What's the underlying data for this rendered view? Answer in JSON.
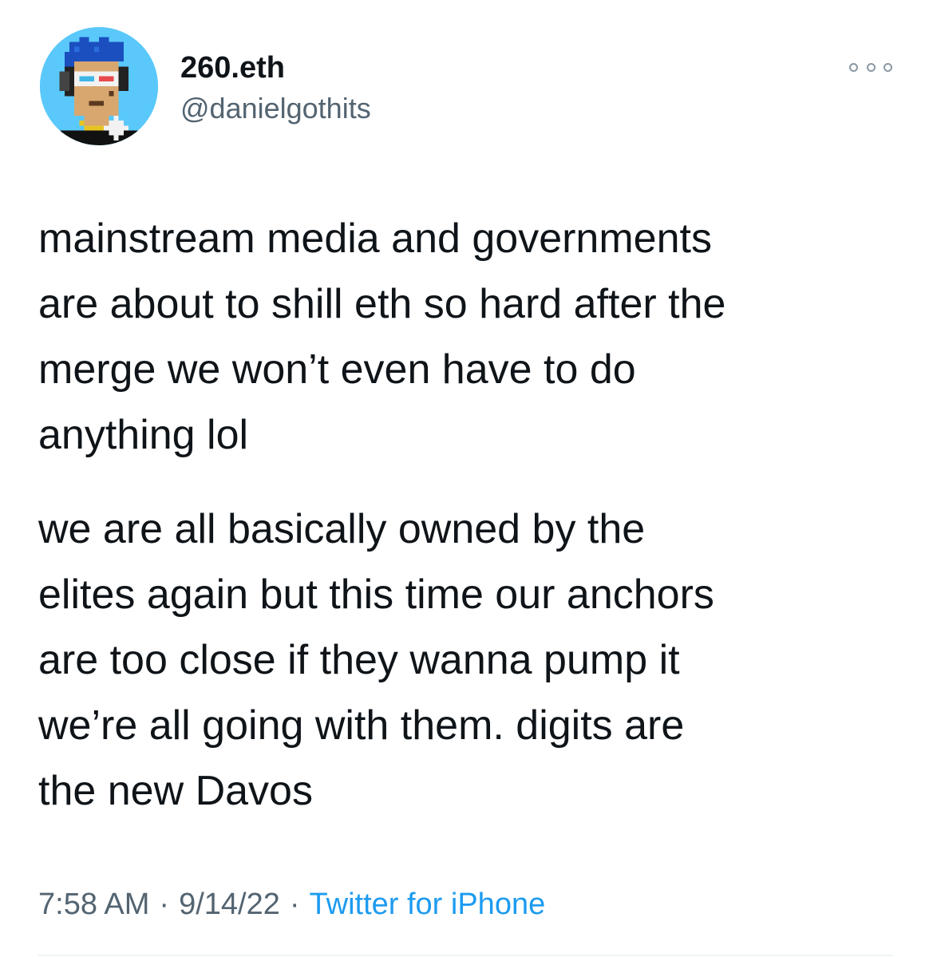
{
  "author": {
    "display_name": "260.eth",
    "handle": "@danielgothits",
    "avatar_icon": "pixel-punk-avatar-icon"
  },
  "more_icon": "ellipsis-icon",
  "tweet": {
    "paragraphs": [
      "mainstream media and governments\nare about to shill eth so hard after the\nmerge we won’t even have to do\nanything lol",
      "we are all basically owned by the\nelites again but this time our anchors\nare too close if they wanna pump it\nwe’re all going with them. digits are\nthe new Davos"
    ]
  },
  "meta": {
    "time": "7:58 AM",
    "separator": "·",
    "date": "9/14/22",
    "source": "Twitter for iPhone"
  },
  "colors": {
    "text": "#0f1419",
    "secondary": "#536471",
    "link": "#1d9bf0",
    "avatar_bg": "#5ac8fa"
  }
}
